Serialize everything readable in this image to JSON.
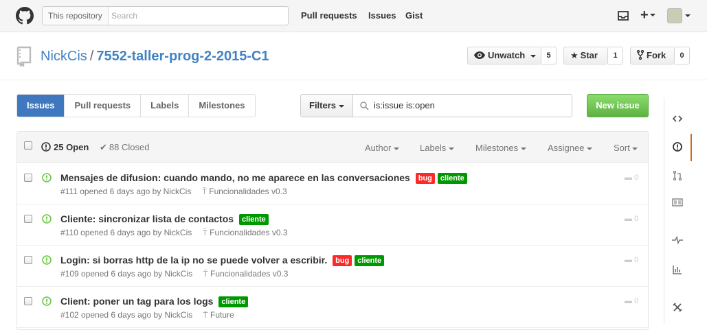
{
  "header": {
    "search_scope": "This repository",
    "search_placeholder": "Search",
    "nav": [
      "Pull requests",
      "Issues",
      "Gist"
    ]
  },
  "repo": {
    "owner": "NickCis",
    "separator": "/",
    "name": "7552-taller-prog-2-2015-C1",
    "unwatch_label": "Unwatch",
    "watch_count": "5",
    "star_label": "Star",
    "star_count": "1",
    "fork_label": "Fork",
    "fork_count": "0"
  },
  "subnav": {
    "tabs": [
      "Issues",
      "Pull requests",
      "Labels",
      "Milestones"
    ],
    "filters_label": "Filters",
    "query": "is:issue is:open",
    "new_issue": "New issue"
  },
  "issues_header": {
    "open": "25 Open",
    "closed": "88 Closed",
    "menus": [
      "Author",
      "Labels",
      "Milestones",
      "Assignee",
      "Sort"
    ]
  },
  "issues": [
    {
      "title": "Mensajes de difusion: cuando mando, no me aparece en las conversaciones",
      "labels": [
        "bug",
        "cliente"
      ],
      "meta": "#111 opened 6 days ago by NickCis",
      "milestone": "Funcionalidades v0.3",
      "comments": "0"
    },
    {
      "title": "Cliente: sincronizar lista de contactos",
      "labels": [
        "cliente"
      ],
      "meta": "#110 opened 6 days ago by NickCis",
      "milestone": "Funcionalidades v0.3",
      "comments": "0"
    },
    {
      "title": "Login: si borras http de la ip no se puede volver a escribir.",
      "labels": [
        "bug",
        "cliente"
      ],
      "meta": "#109 opened 6 days ago by NickCis",
      "milestone": "Funcionalidades v0.3",
      "comments": "0"
    },
    {
      "title": "Client: poner un tag para los logs",
      "labels": [
        "cliente"
      ],
      "meta": "#102 opened 6 days ago by NickCis",
      "milestone": "Future",
      "comments": "0"
    }
  ],
  "colors": {
    "link": "#4183c4",
    "selected_tab": "#4078c0",
    "new_issue": "#6cc644",
    "label_bug": "#fc2929",
    "label_cliente": "#009800",
    "open_icon": "#6cc644",
    "sidebar_active": "#d26911"
  },
  "sidebar_icons": [
    "code-icon",
    "issue-opened-icon",
    "pull-request-icon",
    "wiki-icon",
    "pulse-icon",
    "graph-icon",
    "settings-icon"
  ]
}
